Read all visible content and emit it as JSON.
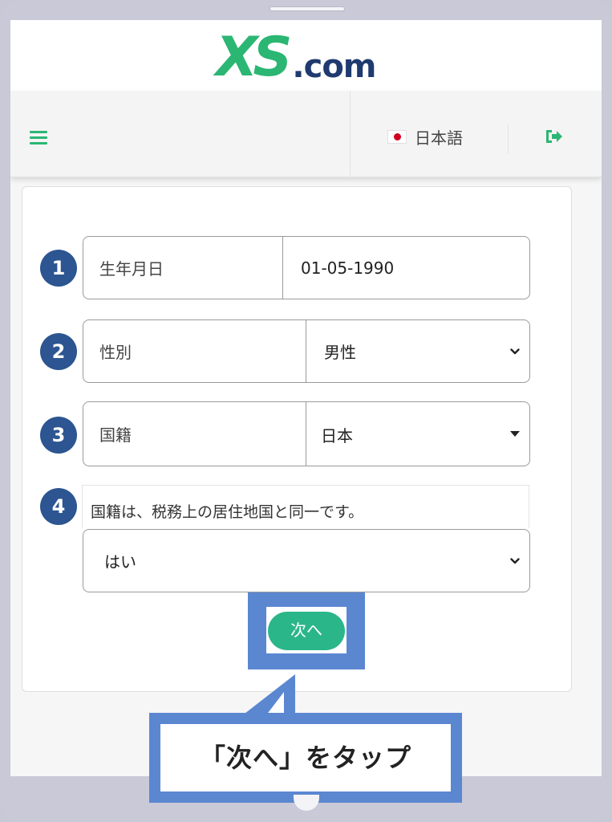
{
  "logo": {
    "brand": "XS",
    "suffix": ".com"
  },
  "navbar": {
    "language": "日本語"
  },
  "steps": {
    "s1": "1",
    "s2": "2",
    "s3": "3",
    "s4": "4"
  },
  "form": {
    "birthdate": {
      "label": "生年月日",
      "value": "01-05-1990"
    },
    "gender": {
      "label": "性別",
      "value": "男性"
    },
    "nationality": {
      "label": "国籍",
      "value": "日本"
    },
    "tax_residence": {
      "question": "国籍は、税務上の居住地国と同一です。",
      "value": "はい"
    },
    "next_label": "次へ"
  },
  "callout": {
    "text": "「次へ」をタップ"
  },
  "colors": {
    "brand_green": "#2bb673",
    "accent_blue": "#5b87d1",
    "step_blue": "#2c5591"
  }
}
